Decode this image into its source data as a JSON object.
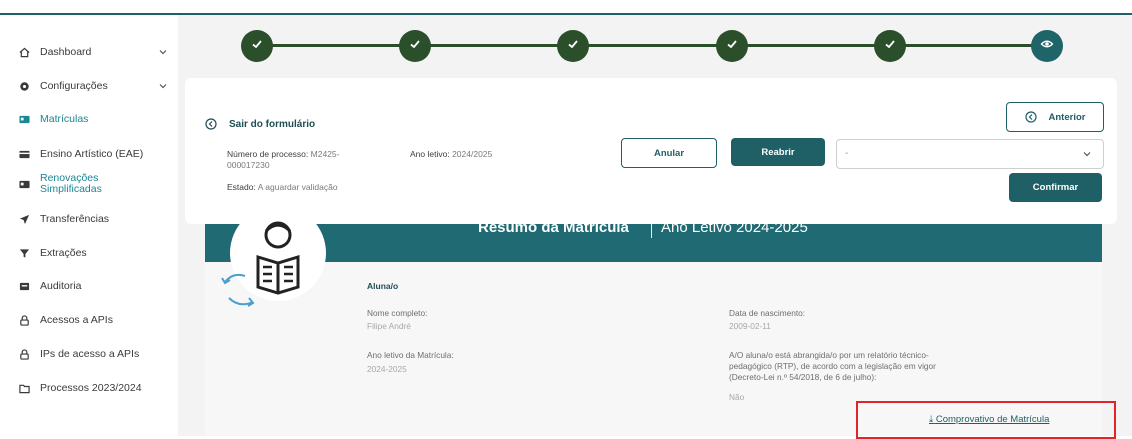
{
  "sidebar": {
    "items": [
      {
        "label": "Dashboard",
        "icon": "home-icon",
        "has_chevron": true
      },
      {
        "label": "Configurações",
        "icon": "gear-icon",
        "has_chevron": true
      },
      {
        "label": "Matrículas",
        "icon": "id-card-icon",
        "active": true
      },
      {
        "label": "Ensino Artístico (EAE)",
        "icon": "card-icon"
      },
      {
        "label": "Renovações Simplificadas",
        "icon": "id-card-icon"
      },
      {
        "label": "Transferências",
        "icon": "send-icon"
      },
      {
        "label": "Extrações",
        "icon": "filter-icon"
      },
      {
        "label": "Auditoria",
        "icon": "inbox-icon"
      },
      {
        "label": "Acessos a APIs",
        "icon": "lock-icon"
      },
      {
        "label": "IPs de acesso a APIs",
        "icon": "lock-icon"
      },
      {
        "label": "Processos 2023/2024",
        "icon": "folder-icon"
      }
    ]
  },
  "stepper": {
    "steps": [
      {
        "state": "done",
        "icon": "check-icon"
      },
      {
        "state": "done",
        "icon": "check-icon"
      },
      {
        "state": "done",
        "icon": "check-icon"
      },
      {
        "state": "done",
        "icon": "check-icon"
      },
      {
        "state": "done",
        "icon": "check-icon"
      },
      {
        "state": "current",
        "icon": "eye-icon"
      }
    ]
  },
  "form": {
    "exit_label": "Sair do formulário",
    "process_label": "Número de processo:",
    "process_value_1": "M2425-",
    "process_value_2": "000017230",
    "year_label": "Ano letivo:",
    "year_value": "2024/2025",
    "state_label": "Estado:",
    "state_value": "A aguardar validação",
    "anular_label": "Anular",
    "reabrir_label": "Reabrir",
    "anterior_label": "Anterior",
    "select_value": "-",
    "confirmar_label": "Confirmar"
  },
  "summary": {
    "title": "Resumo da Matrícula",
    "subtitle": "Ano Letivo 2024-2025",
    "section": "Aluna/o",
    "nome_label": "Nome completo:",
    "nome_value": "Filipe André",
    "nasc_label": "Data de nascimento:",
    "nasc_value": "2009-02-11",
    "ano_label": "Ano letivo da Matrícula:",
    "ano_value": "2024-2025",
    "rtp_line1": "A/O aluna/o está abrangida/o por um relatório técnico-",
    "rtp_line2": "pedagógico (RTP), de acordo com a legislação em vigor",
    "rtp_line3": "(Decreto-Lei n.º 54/2018, de 6 de julho):",
    "rtp_value": "Não",
    "download_label": "Comprovativo de Matrícula"
  },
  "colors": {
    "accent": "#1f5f66",
    "step_done": "#2b4f2b",
    "step_current": "#1e6469",
    "active_nav": "#1a8796",
    "highlight": "#e2232a"
  }
}
